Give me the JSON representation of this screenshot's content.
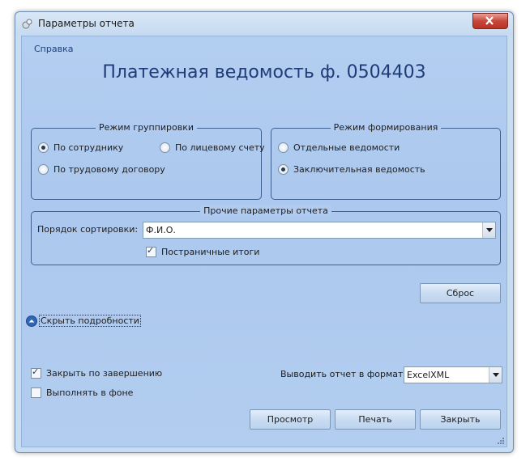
{
  "window": {
    "title": "Параметры отчета"
  },
  "menu": {
    "help": "Справка"
  },
  "report_title": "Платежная ведомость ф. 0504403",
  "grouping": {
    "caption": "Режим группировки",
    "options": [
      {
        "label": "По сотруднику",
        "selected": true
      },
      {
        "label": "По лицевому счету",
        "selected": false
      },
      {
        "label": "По трудовому договору",
        "selected": false
      }
    ]
  },
  "forming": {
    "caption": "Режим формирования",
    "options": [
      {
        "label": "Отдельные ведомости",
        "selected": false
      },
      {
        "label": "Заключительная ведомость",
        "selected": true
      }
    ]
  },
  "other": {
    "caption": "Прочие параметры отчета",
    "sort_label": "Порядок сортировки:",
    "sort_value": "Ф.И.О.",
    "page_totals": {
      "label": "Постраничные итоги",
      "checked": true
    }
  },
  "reset_button": "Сброс",
  "details_toggle": "Скрыть подробности",
  "close_on_finish": {
    "label": "Закрыть по завершению",
    "checked": true
  },
  "run_background": {
    "label": "Выполнять в фоне",
    "checked": false
  },
  "output_format": {
    "label": "Выводить отчет в формате",
    "value": "ExcelXML"
  },
  "buttons": {
    "preview": "Просмотр",
    "print": "Печать",
    "close": "Закрыть"
  },
  "colors": {
    "accent": "#1f3c78",
    "client_bg": "#b0cbef",
    "close_red": "#c7473a"
  }
}
